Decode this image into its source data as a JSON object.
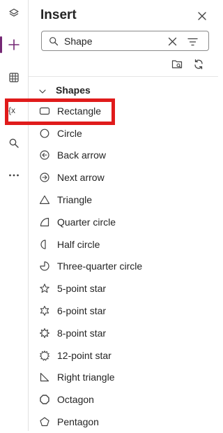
{
  "panel": {
    "title": "Insert"
  },
  "search": {
    "value": "Shape",
    "placeholder": "Search"
  },
  "section": {
    "label": "Shapes"
  },
  "items": [
    {
      "label": "Rectangle",
      "icon": "rectangle-icon"
    },
    {
      "label": "Circle",
      "icon": "circle-icon"
    },
    {
      "label": "Back arrow",
      "icon": "back-arrow-icon"
    },
    {
      "label": "Next arrow",
      "icon": "next-arrow-icon"
    },
    {
      "label": "Triangle",
      "icon": "triangle-icon"
    },
    {
      "label": "Quarter circle",
      "icon": "quarter-circle-icon"
    },
    {
      "label": "Half circle",
      "icon": "half-circle-icon"
    },
    {
      "label": "Three-quarter circle",
      "icon": "three-quarter-circle-icon"
    },
    {
      "label": "5-point star",
      "icon": "five-point-star-icon"
    },
    {
      "label": "6-point star",
      "icon": "six-point-star-icon"
    },
    {
      "label": "8-point star",
      "icon": "eight-point-star-icon"
    },
    {
      "label": "12-point star",
      "icon": "twelve-point-star-icon"
    },
    {
      "label": "Right triangle",
      "icon": "right-triangle-icon"
    },
    {
      "label": "Octagon",
      "icon": "octagon-icon"
    },
    {
      "label": "Pentagon",
      "icon": "pentagon-icon"
    }
  ],
  "colors": {
    "accent": "#742774",
    "highlight": "#e01b1b"
  }
}
